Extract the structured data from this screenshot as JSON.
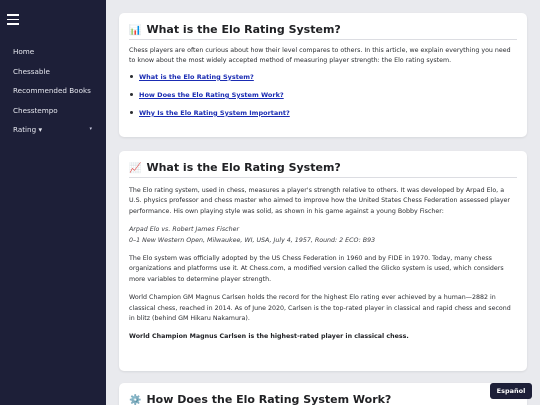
{
  "sidebar": {
    "menu_icon": "hamburger-menu-icon",
    "items": [
      {
        "label": "Home"
      },
      {
        "label": "Chessable"
      },
      {
        "label": "Recommended Books"
      },
      {
        "label": "Chesstempo"
      },
      {
        "label": "Rating ▾",
        "caret": "▾"
      }
    ]
  },
  "intro": {
    "icon": "📊",
    "title": "What is the Elo Rating System?",
    "text": "Chess players are often curious about how their level compares to others. In this article, we explain everything you need to know about the most widely accepted method of measuring player strength: the Elo rating system.",
    "toc": [
      "What is the Elo Rating System?",
      "How Does the Elo Rating System Work?",
      "Why Is the Elo Rating System Important?"
    ]
  },
  "section1": {
    "icon": "📈",
    "title": "What is the Elo Rating System?",
    "p1": "The Elo rating system, used in chess, measures a player's strength relative to others. It was developed by Arpad Elo, a U.S. physics professor and chess master who aimed to improve how the United States Chess Federation assessed player performance. His own playing style was solid, as shown in his game against a young Bobby Fischer:",
    "game_line1": "Arpad Elo vs. Robert James Fischer",
    "game_line2": "0–1 New Western Open, Milwaukee, WI, USA, July 4, 1957, Round: 2 ECO: B93",
    "p2": "The Elo system was officially adopted by the US Chess Federation in 1960 and by FIDE in 1970. Today, many chess organizations and platforms use it. At Chess.com, a modified version called the Glicko system is used, which considers more variables to determine player strength.",
    "p3": "World Champion GM Magnus Carlsen holds the record for the highest Elo rating ever achieved by a human—2882 in classical chess, reached in 2014. As of June 2020, Carlsen is the top-rated player in classical and rapid chess and second in blitz (behind GM Hikaru Nakamura).",
    "p4": "World Champion Magnus Carlsen is the highest-rated player in classical chess."
  },
  "section2": {
    "icon": "⚙️",
    "title": "How Does the Elo Rating System Work?"
  },
  "language_button": "Español"
}
